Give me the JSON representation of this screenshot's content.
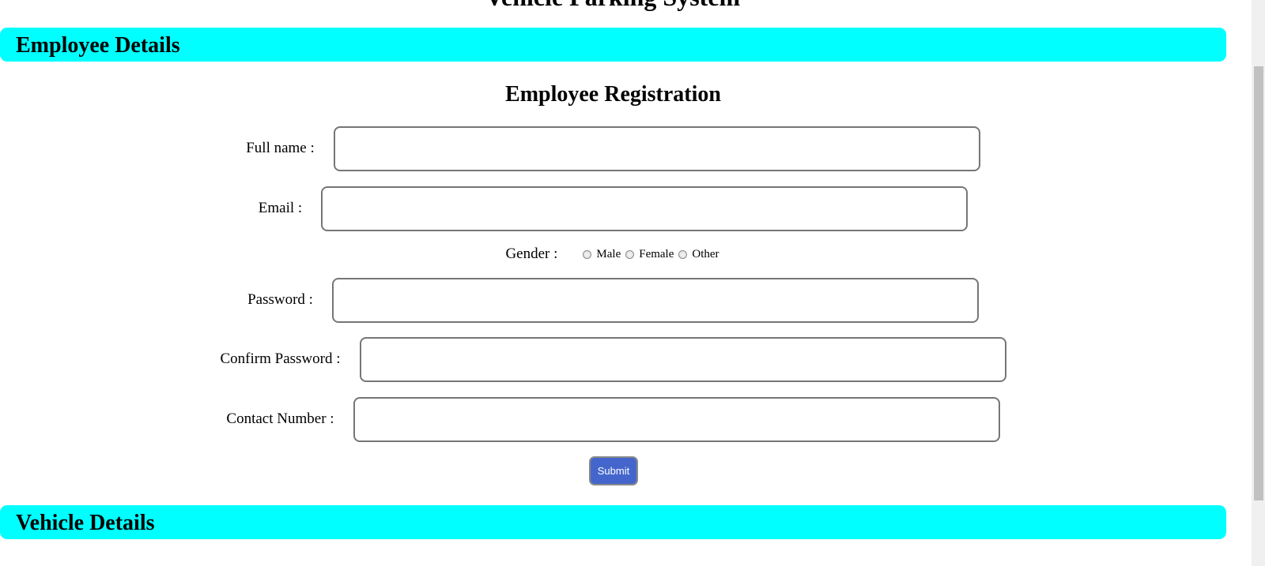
{
  "page": {
    "top_title": "Vehicle Parking System"
  },
  "sections": {
    "employee": "Employee Details",
    "vehicle": "Vehicle Details"
  },
  "form": {
    "title": "Employee Registration",
    "fullname_label": "Full name :",
    "email_label": "Email :",
    "gender_label": "Gender :",
    "gender_options": [
      "Male",
      "Female",
      "Other"
    ],
    "password_label": "Password :",
    "confirm_password_label": "Confirm Password :",
    "contact_label": "Contact Number :",
    "fullname_value": "",
    "email_value": "",
    "password_value": "",
    "confirm_password_value": "",
    "contact_value": "",
    "submit_label": "Submit"
  },
  "colors": {
    "section_bar": "#00ffff",
    "submit_button": "#4466cc"
  }
}
